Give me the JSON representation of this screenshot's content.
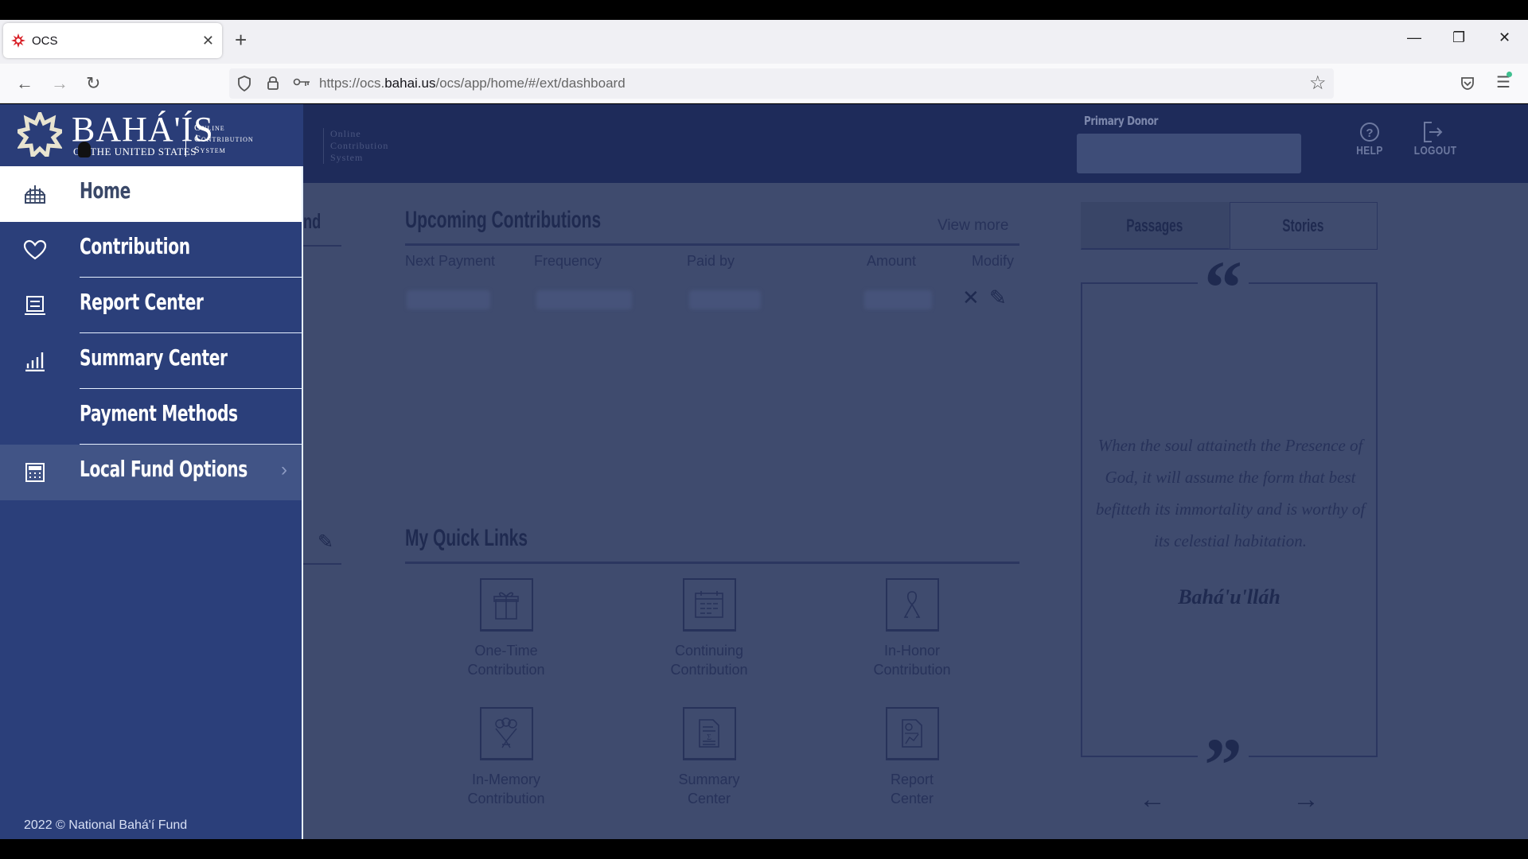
{
  "browser": {
    "tab_title": "OCS",
    "url_prefix": "https://ocs.",
    "url_domain": "bahai.us",
    "url_path": "/ocs/app/home/#/ext/dashboard",
    "icons": {
      "favicon": "nine-pointed-star-icon",
      "close_tab": "close-icon",
      "new_tab": "plus-icon",
      "back": "arrow-left-icon",
      "forward": "arrow-right-icon",
      "reload": "reload-icon",
      "shield": "shield-icon",
      "lock": "lock-icon",
      "key": "key-icon",
      "bookmark": "star-icon",
      "pocket": "pocket-icon",
      "menu": "hamburger-menu-icon",
      "minimize": "minimize-icon",
      "restore": "restore-icon",
      "close_window": "close-icon"
    },
    "glyphs": {
      "close_tab": "✕",
      "new_tab": "+",
      "back": "←",
      "forward": "→",
      "reload": "↻",
      "minimize": "—",
      "restore": "❐",
      "close_window": "✕",
      "star": "☆",
      "menu": "☰"
    }
  },
  "logo": {
    "main": "BAHÁ'ÍS",
    "sub": "OF THE UNITED STATES",
    "ocs_line1": "Online",
    "ocs_line2": "Contribution",
    "ocs_line3": "System"
  },
  "header": {
    "faded_logo_line1": "Online",
    "faded_logo_line2": "Contribution",
    "faded_logo_line3": "System",
    "primary_donor_label": "Primary Donor",
    "primary_donor_value": "",
    "help_label": "HELP",
    "logout_label": "LOGOUT"
  },
  "sidebar": {
    "items": [
      {
        "label": "Home",
        "icon": "temple-icon",
        "active": true
      },
      {
        "label": "Contribution",
        "icon": "heart-icon"
      },
      {
        "label": "Report Center",
        "icon": "report-icon"
      },
      {
        "label": "Summary Center",
        "icon": "bar-chart-icon"
      },
      {
        "label": "Payment Methods",
        "icon": ""
      },
      {
        "label": "Local Fund Options",
        "icon": "calculator-icon",
        "has_submenu": true
      }
    ],
    "chevron": "›",
    "copyright": "2022 © National Bahá'í Fund"
  },
  "main": {
    "cut_section_title_fragment": "nd",
    "upcoming": {
      "title": "Upcoming Contributions",
      "view_more": "View more",
      "columns": [
        "Next Payment",
        "Frequency",
        "Paid by",
        "Amount",
        "Modify"
      ],
      "row_delete_glyph": "✕",
      "row_edit_glyph": "✎"
    },
    "quick_links": {
      "title": "My Quick Links",
      "edit_glyph": "✎",
      "items": [
        {
          "line1": "One-Time",
          "line2": "Contribution",
          "icon": "gift-icon"
        },
        {
          "line1": "Continuing",
          "line2": "Contribution",
          "icon": "calendar-icon"
        },
        {
          "line1": "In-Honor",
          "line2": "Contribution",
          "icon": "ribbon-icon"
        },
        {
          "line1": "In-Memory",
          "line2": "Contribution",
          "icon": "flowers-icon"
        },
        {
          "line1": "Summary",
          "line2": "Center",
          "icon": "summary-document-icon"
        },
        {
          "line1": "Report",
          "line2": "Center",
          "icon": "report-document-icon"
        }
      ]
    }
  },
  "passages": {
    "tabs": [
      {
        "label": "Passages",
        "active": true
      },
      {
        "label": "Stories"
      }
    ],
    "open_quote": "“",
    "close_quote": "”",
    "quote": "When the soul attaineth the Presence of God, it will assume the form that best befitteth its immortality and is worthy of its celestial habitation.",
    "author": "Bahá'u'lláh",
    "prev_glyph": "←",
    "next_glyph": "→"
  }
}
